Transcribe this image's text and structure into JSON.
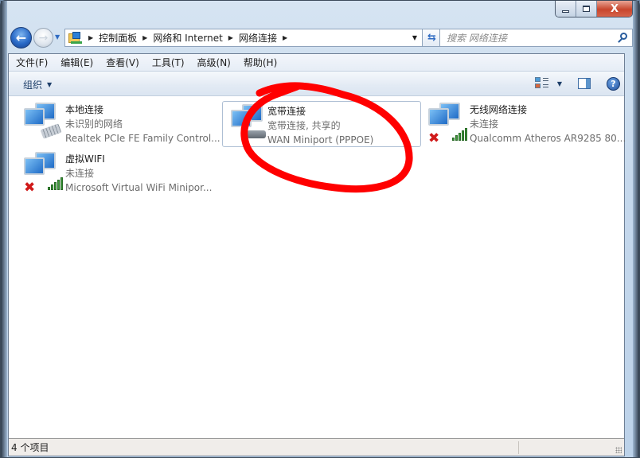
{
  "window": {
    "caption_buttons": {
      "minimize": "minimize",
      "maximize": "maximize",
      "close": "X"
    }
  },
  "navigation": {
    "back_icon": "back-arrow-icon",
    "forward_icon": "forward-arrow-icon",
    "breadcrumbs": [
      "控制面板",
      "网络和 Internet",
      "网络连接"
    ],
    "search_placeholder": "搜索 网络连接"
  },
  "menubar": {
    "items": [
      "文件(F)",
      "编辑(E)",
      "查看(V)",
      "工具(T)",
      "高级(N)",
      "帮助(H)"
    ]
  },
  "toolbar": {
    "organize_label": "组织",
    "help_glyph": "?"
  },
  "connections": [
    {
      "name": "本地连接",
      "status": "未识别的网络",
      "adapter": "Realtek PCIe FE Family Control...",
      "type": "wired",
      "disconnected": false,
      "selected": false
    },
    {
      "name": "宽带连接",
      "status": "宽带连接, 共享的",
      "adapter": "WAN Miniport (PPPOE)",
      "type": "broadband",
      "disconnected": false,
      "selected": true
    },
    {
      "name": "无线网络连接",
      "status": "未连接",
      "adapter": "Qualcomm Atheros AR9285 80...",
      "type": "wireless",
      "disconnected": true,
      "selected": false
    },
    {
      "name": "虚拟WIFI",
      "status": "未连接",
      "adapter": "Microsoft Virtual WiFi Minipor...",
      "type": "wireless",
      "disconnected": true,
      "selected": false
    }
  ],
  "statusbar": {
    "item_count": "4 个项目"
  },
  "annotation": {
    "color": "#ff0000",
    "target": "宽带连接"
  }
}
